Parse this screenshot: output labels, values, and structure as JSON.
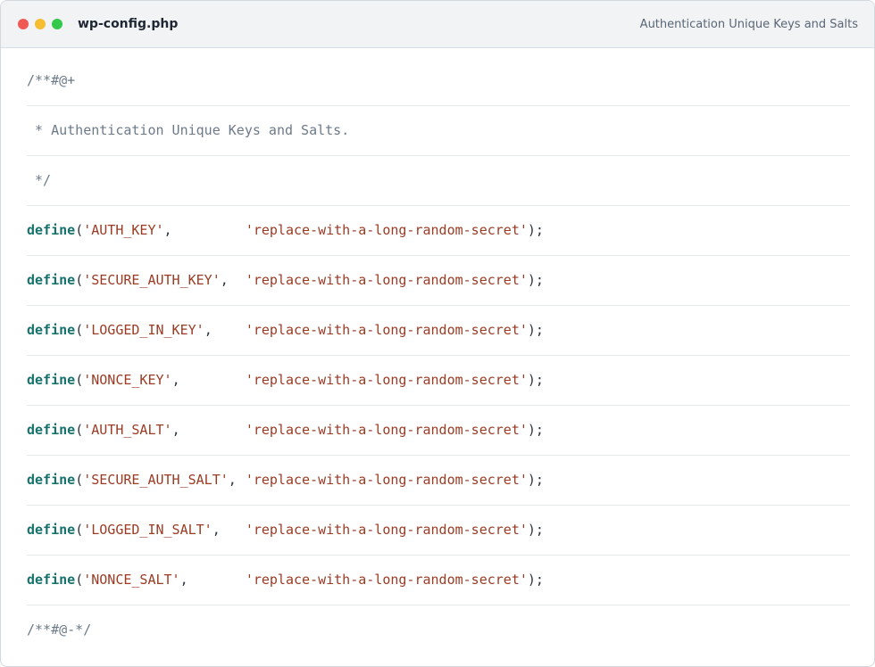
{
  "window": {
    "filename": "wp-config.php",
    "subtitle": "Authentication Unique Keys and Salts"
  },
  "colors": {
    "close": "#f05a55",
    "minimize": "#f5bd2f",
    "maximize": "#34c94a",
    "keyword": "#16726c",
    "string": "#9a3b24",
    "comment": "#6c7a89"
  },
  "code": {
    "comment_open": "/**#@+",
    "comment_body": " * Authentication Unique Keys and Salts.",
    "comment_close": " */",
    "keyword": "define",
    "open_paren": "(",
    "comma": ",",
    "close_paren": ");",
    "defines": [
      {
        "name": "'AUTH_KEY'",
        "value": "'replace-with-a-long-random-secret'"
      },
      {
        "name": "'SECURE_AUTH_KEY'",
        "value": "'replace-with-a-long-random-secret'"
      },
      {
        "name": "'LOGGED_IN_KEY'",
        "value": "'replace-with-a-long-random-secret'"
      },
      {
        "name": "'NONCE_KEY'",
        "value": "'replace-with-a-long-random-secret'"
      },
      {
        "name": "'AUTH_SALT'",
        "value": "'replace-with-a-long-random-secret'"
      },
      {
        "name": "'SECURE_AUTH_SALT'",
        "value": "'replace-with-a-long-random-secret'"
      },
      {
        "name": "'LOGGED_IN_SALT'",
        "value": "'replace-with-a-long-random-secret'"
      },
      {
        "name": "'NONCE_SALT'",
        "value": "'replace-with-a-long-random-secret'"
      }
    ],
    "end_marker": "/**#@-*/"
  }
}
